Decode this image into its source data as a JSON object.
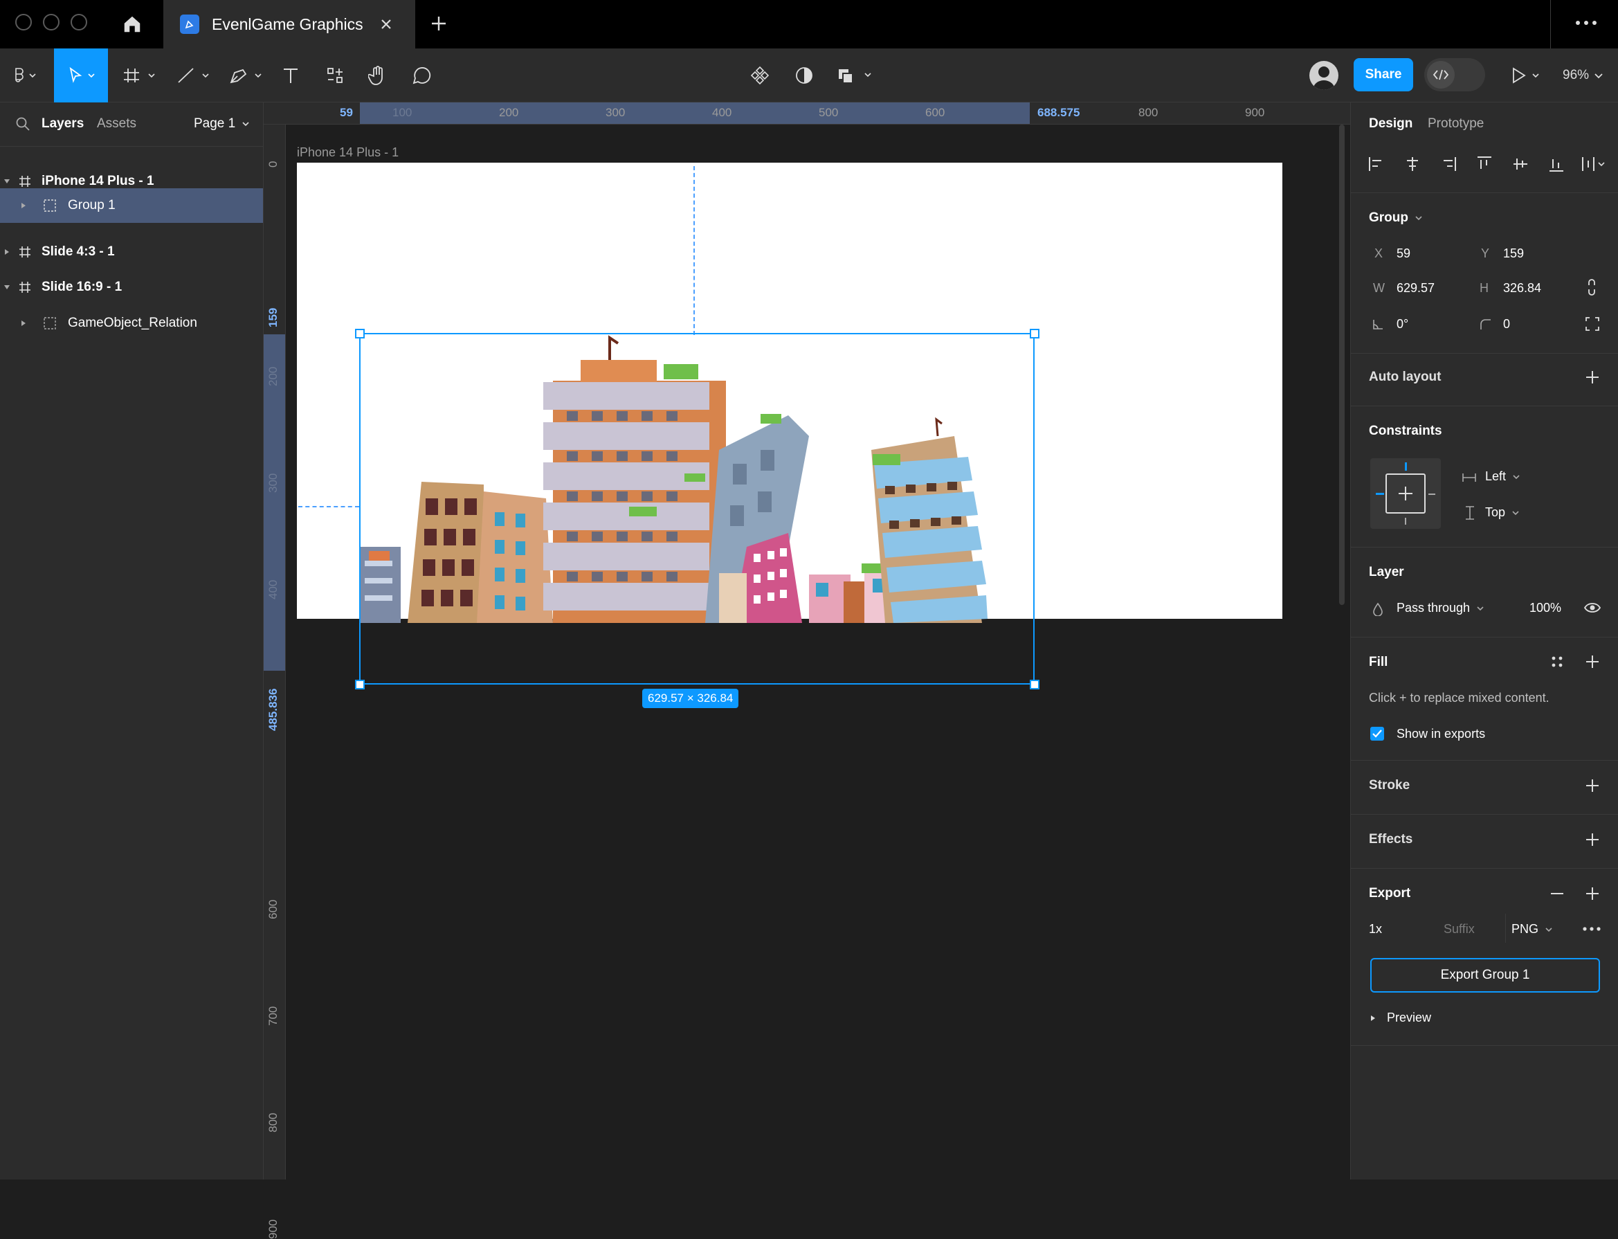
{
  "tab": {
    "title": "EvenlGame Graphics"
  },
  "toolbar": {
    "share_label": "Share",
    "zoom": "96%"
  },
  "left_panel": {
    "tabs": [
      "Layers",
      "Assets"
    ],
    "page_selector": "Page 1",
    "layers": [
      {
        "name": "iPhone 14 Plus - 1",
        "kind": "frame",
        "bold": true
      },
      {
        "name": "Group 1",
        "kind": "group",
        "bold": false,
        "selected": true
      },
      {
        "name": "Slide 4:3 - 1",
        "kind": "frame",
        "bold": true
      },
      {
        "name": "Slide 16:9 - 1",
        "kind": "frame",
        "bold": true
      },
      {
        "name": "GameObject_Relation",
        "kind": "group",
        "bold": false
      }
    ]
  },
  "ruler": {
    "top_ticks": [
      "100",
      "200",
      "300",
      "400",
      "500",
      "600",
      "800",
      "900"
    ],
    "top_highlight_start": "59",
    "top_highlight_end": "688.575",
    "left_ticks": [
      "0",
      "200",
      "300",
      "400",
      "600",
      "700",
      "800",
      "900"
    ],
    "left_highlight_start": "159",
    "left_highlight_end": "485.836"
  },
  "canvas": {
    "frame_label": "iPhone 14 Plus - 1",
    "size_badge": "629.57 × 326.84"
  },
  "design": {
    "tabs": [
      "Design",
      "Prototype"
    ],
    "group_title": "Group",
    "x_label": "X",
    "x": "59",
    "y_label": "Y",
    "y": "159",
    "w_label": "W",
    "w": "629.57",
    "h_label": "H",
    "h": "326.84",
    "rotation": "0°",
    "radius": "0",
    "auto_layout": "Auto layout",
    "constraints": "Constraints",
    "constraint_h": "Left",
    "constraint_v": "Top",
    "layer": "Layer",
    "blend": "Pass through",
    "opacity": "100%",
    "fill": "Fill",
    "fill_note": "Click + to replace mixed content.",
    "show_in_exports": "Show in exports",
    "stroke": "Stroke",
    "effects": "Effects",
    "export": "Export",
    "export_scale": "1x",
    "export_suffix_placeholder": "Suffix",
    "export_format": "PNG",
    "export_button": "Export Group 1",
    "preview": "Preview"
  },
  "colors": {
    "accent": "#0d99ff",
    "selection_bg": "#4a5a7a",
    "bg": "#1e1e1e",
    "panel": "#2c2c2c"
  }
}
